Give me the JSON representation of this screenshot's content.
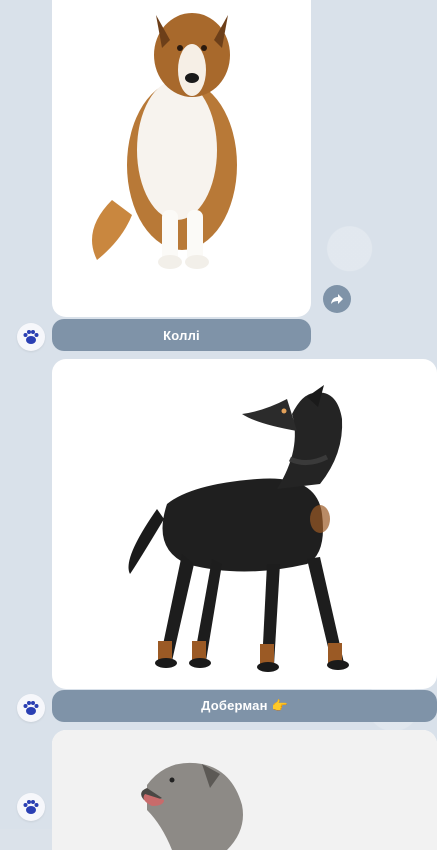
{
  "chat": {
    "messages": [
      {
        "caption": "Коллі"
      },
      {
        "caption": "Доберман 👉"
      },
      {
        "caption": ""
      }
    ]
  },
  "icons": {
    "avatar": "paw-icon",
    "share": "share-arrow-icon"
  },
  "colors": {
    "background": "#d9e1ea",
    "caption_button": "#7f93a8",
    "paw": "#2a3fb3"
  }
}
